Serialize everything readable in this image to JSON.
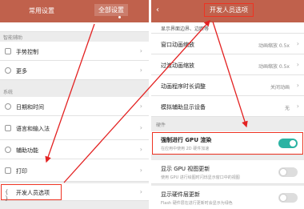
{
  "left": {
    "tabs": [
      "常用设置",
      "全部设置"
    ],
    "sections": {
      "assist": "智能辅助",
      "system": "系统"
    },
    "items": {
      "gesture": "手势控制",
      "more": "更多",
      "datetime": "日期和时间",
      "language": "语言和输入法",
      "accessibility": "辅助功能",
      "print": "打印",
      "developer": "开发人员选项"
    }
  },
  "right": {
    "back_glyph": "‹",
    "title": "开发人员选项",
    "partial_top": "显示界面边界、边距等",
    "rows": [
      {
        "label": "窗口动画缩放",
        "value": "动画缩放 0.5x"
      },
      {
        "label": "过渡动画缩放",
        "value": "动画缩放 0.5x"
      },
      {
        "label": "动画程序时长调整",
        "value": "关闭动画"
      },
      {
        "label": "模拟辅助显示设备",
        "value": "无"
      }
    ],
    "hardware_section": "硬件",
    "gpu": {
      "label": "强制进行 GPU 渲染",
      "sub": "在应用中使用 2D 硬件加速",
      "enabled": true
    },
    "gpu_view": {
      "label": "显示 GPU 视图更新",
      "sub": "使用 GPU 进行绘图时闪烁显示窗口中的视图",
      "enabled": false
    },
    "hw_layer": {
      "label": "显示硬件层更新",
      "sub": "Flash 硬件层在进行更新时会显示为绿色",
      "enabled": false
    }
  },
  "colors": {
    "header": "#c0614c",
    "annotation": "#e32222",
    "toggle_on": "#2bb3a3"
  },
  "chevron_glyph": "›"
}
